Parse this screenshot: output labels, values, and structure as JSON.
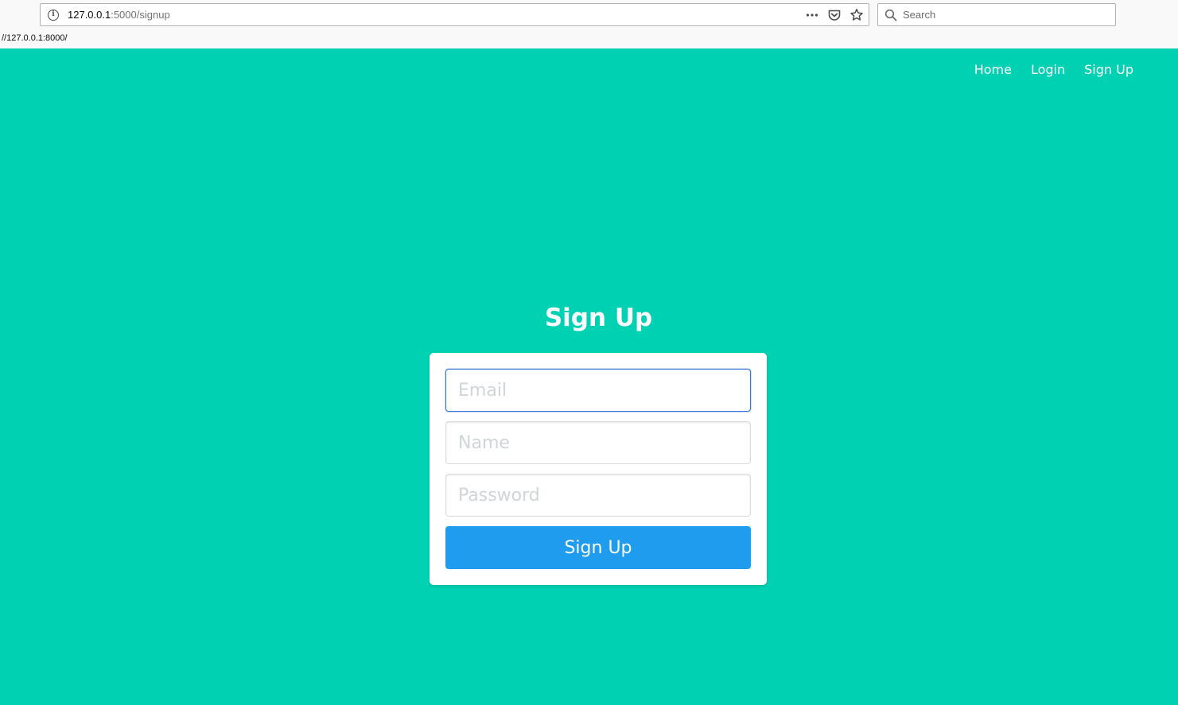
{
  "browser": {
    "url_host": "127.0.0.1",
    "url_path": ":5000/signup",
    "search_placeholder": "Search",
    "status_url": "//127.0.0.1:8000/"
  },
  "nav": {
    "items": [
      {
        "label": "Home"
      },
      {
        "label": "Login"
      },
      {
        "label": "Sign Up"
      }
    ]
  },
  "form": {
    "title": "Sign Up",
    "email_placeholder": "Email",
    "email_value": "",
    "name_placeholder": "Name",
    "name_value": "",
    "password_placeholder": "Password",
    "password_value": "",
    "submit_label": "Sign Up"
  },
  "colors": {
    "page_background": "#00d1b2",
    "button_background": "#209cee",
    "focus_border": "#3273dc"
  },
  "icons": {
    "info": "info-icon",
    "more": "more-icon",
    "pocket": "pocket-icon",
    "bookmark": "bookmark-star-icon",
    "search": "search-icon"
  }
}
